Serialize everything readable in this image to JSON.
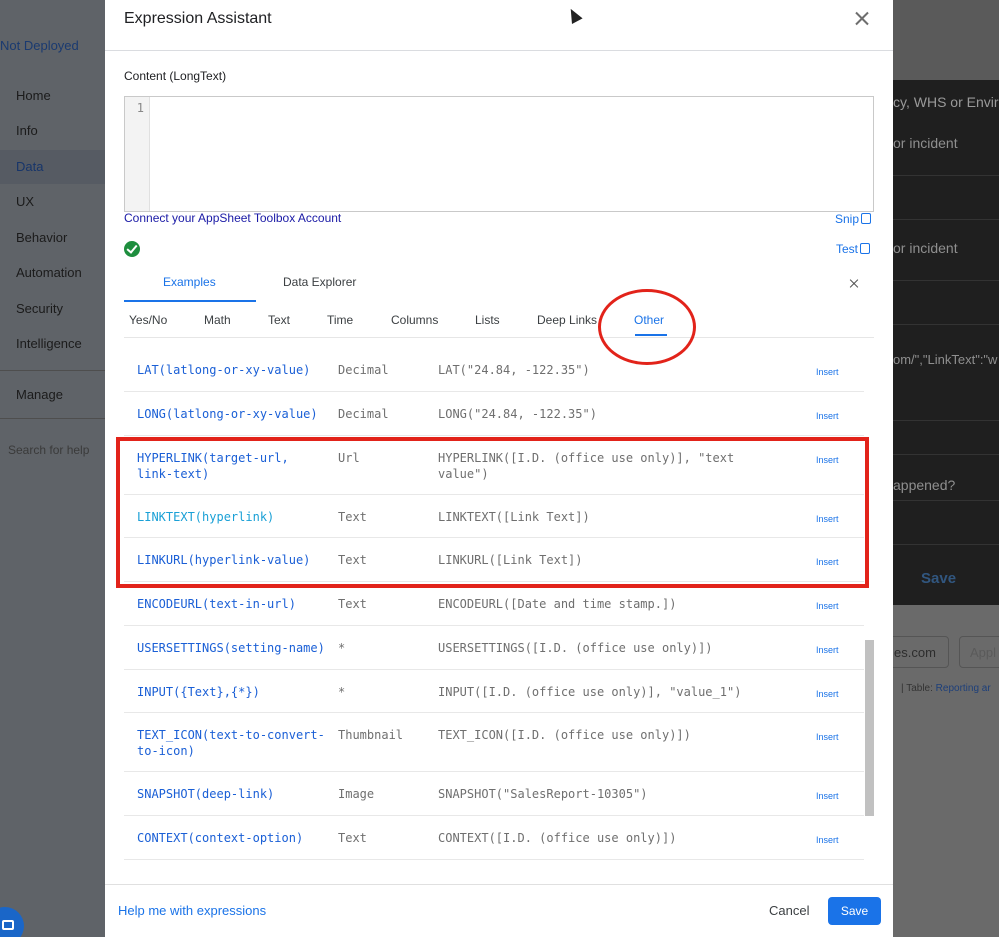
{
  "background": {
    "left_nav": {
      "deploy_status": "Not Deployed",
      "items": [
        {
          "label": "Home"
        },
        {
          "label": "Info"
        },
        {
          "label": "Data"
        },
        {
          "label": "UX"
        },
        {
          "label": "Behavior"
        },
        {
          "label": "Automation"
        },
        {
          "label": "Security"
        },
        {
          "label": "Intelligence"
        },
        {
          "label": "Manage"
        }
      ],
      "search_placeholder": "Search for help"
    },
    "right_panel": {
      "header_text": "cy, WHS or Enviro",
      "label_1": "or incident",
      "label_2": "or incident",
      "json_snippet": "om/\",\"LinkText\":\"w",
      "question": "appened?",
      "save_label": "Save",
      "email_fragment": "es.com",
      "button_fragment": "Appl",
      "table_prefix": "|   Table:",
      "table_link": "Reporting ar"
    }
  },
  "dialog": {
    "title": "Expression Assistant",
    "content_label": "Content (LongText)",
    "line_number": "1",
    "connect_link": "Connect your AppSheet Toolbox Account",
    "snip_label": "Snip",
    "test_label": "Test",
    "tabs": [
      {
        "label": "Examples"
      },
      {
        "label": "Data Explorer"
      }
    ],
    "subtabs": [
      {
        "label": "Yes/No"
      },
      {
        "label": "Math"
      },
      {
        "label": "Text"
      },
      {
        "label": "Time"
      },
      {
        "label": "Columns"
      },
      {
        "label": "Lists"
      },
      {
        "label": "Deep Links"
      },
      {
        "label": "Other"
      }
    ],
    "insert_label": "Insert",
    "rows": [
      {
        "fn": "LAT(latlong-or-xy-value)",
        "type": "Decimal",
        "example": "LAT(\"24.84, -122.35\")"
      },
      {
        "fn": "LONG(latlong-or-xy-value)",
        "type": "Decimal",
        "example": "LONG(\"24.84, -122.35\")"
      },
      {
        "fn": "HYPERLINK(target-url, link-text)",
        "type": "Url",
        "example": "HYPERLINK([I.D. (office use only)], \"text value\")"
      },
      {
        "fn": "LINKTEXT(hyperlink)",
        "type": "Text",
        "example": "LINKTEXT([Link Text])"
      },
      {
        "fn": "LINKURL(hyperlink-value)",
        "type": "Text",
        "example": "LINKURL([Link Text])"
      },
      {
        "fn": "ENCODEURL(text-in-url)",
        "type": "Text",
        "example": "ENCODEURL([Date and time stamp.])"
      },
      {
        "fn": "USERSETTINGS(setting-name)",
        "type": "*",
        "example": "USERSETTINGS([I.D. (office use only)])"
      },
      {
        "fn": "INPUT({Text},{*})",
        "type": "*",
        "example": "INPUT([I.D. (office use only)], \"value_1\")"
      },
      {
        "fn": "TEXT_ICON(text-to-convert-to-icon)",
        "type": "Thumbnail",
        "example": "TEXT_ICON([I.D. (office use only)])"
      },
      {
        "fn": "SNAPSHOT(deep-link)",
        "type": "Image",
        "example": "SNAPSHOT(\"SalesReport-10305\")"
      },
      {
        "fn": "CONTEXT(context-option)",
        "type": "Text",
        "example": "CONTEXT([I.D. (office use only)])"
      }
    ],
    "footer": {
      "help_link": "Help me with expressions",
      "cancel_label": "Cancel",
      "save_label": "Save"
    }
  }
}
